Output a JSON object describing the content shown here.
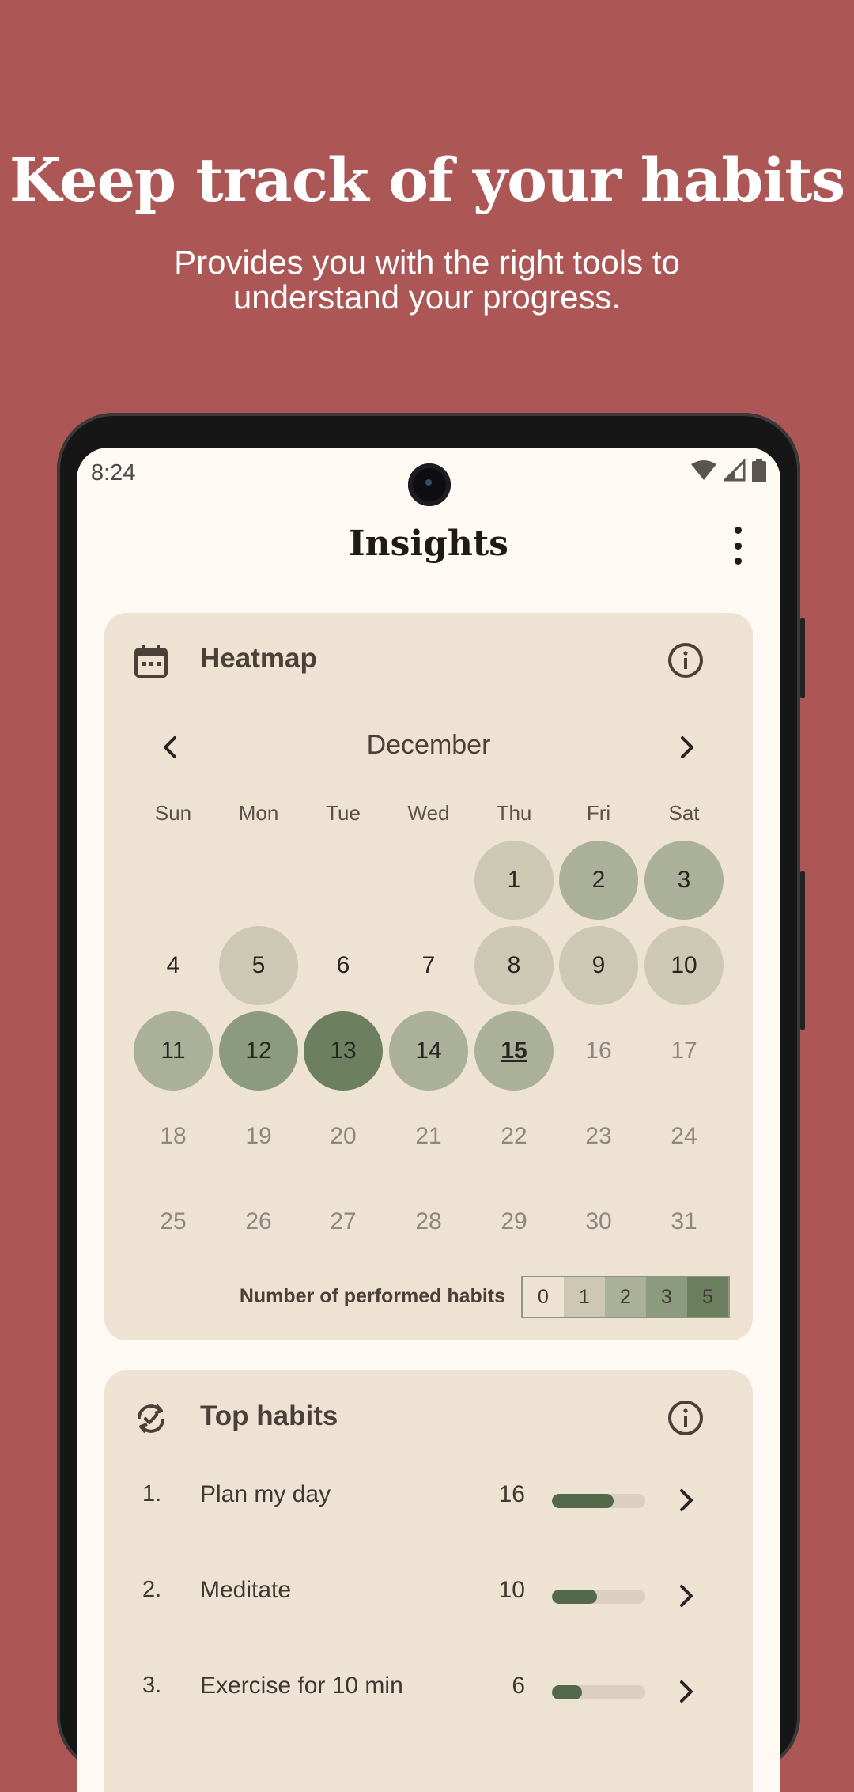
{
  "promo": {
    "title": "Keep track of your habits",
    "subtitle": "Provides you with the right tools to understand your progress."
  },
  "status_bar": {
    "time": "8:24",
    "icons": [
      "wifi-icon",
      "cellular-signal-icon",
      "battery-icon"
    ]
  },
  "app_bar": {
    "title": "Insights",
    "menu_icon": "more-vertical-icon"
  },
  "heatmap": {
    "title": "Heatmap",
    "icon": "calendar-icon",
    "info_icon": "info-icon",
    "month": "December",
    "weekdays": [
      "Sun",
      "Mon",
      "Tue",
      "Wed",
      "Thu",
      "Fri",
      "Sat"
    ],
    "first_weekday_index": 4,
    "today": 15,
    "days": [
      {
        "label": "1",
        "level": 1
      },
      {
        "label": "2",
        "level": 2
      },
      {
        "label": "3",
        "level": 2
      },
      {
        "label": "4",
        "level": 0
      },
      {
        "label": "5",
        "level": 1
      },
      {
        "label": "6",
        "level": 0
      },
      {
        "label": "7",
        "level": 0
      },
      {
        "label": "8",
        "level": 1
      },
      {
        "label": "9",
        "level": 1
      },
      {
        "label": "10",
        "level": 1
      },
      {
        "label": "11",
        "level": 2
      },
      {
        "label": "12",
        "level": 3
      },
      {
        "label": "13",
        "level": 5
      },
      {
        "label": "14",
        "level": 2
      },
      {
        "label": "15",
        "level": 2
      },
      {
        "label": "16",
        "level": null
      },
      {
        "label": "17",
        "level": null
      },
      {
        "label": "18",
        "level": null
      },
      {
        "label": "19",
        "level": null
      },
      {
        "label": "20",
        "level": null
      },
      {
        "label": "21",
        "level": null
      },
      {
        "label": "22",
        "level": null
      },
      {
        "label": "23",
        "level": null
      },
      {
        "label": "24",
        "level": null
      },
      {
        "label": "25",
        "level": null
      },
      {
        "label": "26",
        "level": null
      },
      {
        "label": "27",
        "level": null
      },
      {
        "label": "28",
        "level": null
      },
      {
        "label": "29",
        "level": null
      },
      {
        "label": "30",
        "level": null
      },
      {
        "label": "31",
        "level": null
      }
    ],
    "legend_label": "Number of performed habits",
    "legend": [
      {
        "label": "0",
        "color": "#EEE2D2"
      },
      {
        "label": "1",
        "color": "#CCC8B3"
      },
      {
        "label": "2",
        "color": "#ABB099"
      },
      {
        "label": "3",
        "color": "#8C9A7D"
      },
      {
        "label": "5",
        "color": "#6C8060"
      }
    ]
  },
  "top_habits": {
    "title": "Top habits",
    "icon": "cycle-check-icon",
    "info_icon": "info-icon",
    "items": [
      {
        "rank": "1.",
        "name": "Plan my day",
        "count": "16",
        "fraction": 0.66
      },
      {
        "rank": "2.",
        "name": "Meditate",
        "count": "10",
        "fraction": 0.48
      },
      {
        "rank": "3.",
        "name": "Exercise for 10 min",
        "count": "6",
        "fraction": 0.32
      }
    ]
  },
  "colors": {
    "background": "#AD5656",
    "screen": "#FFF9F4",
    "card": "#EEE2D2",
    "accent": "#52694A"
  }
}
